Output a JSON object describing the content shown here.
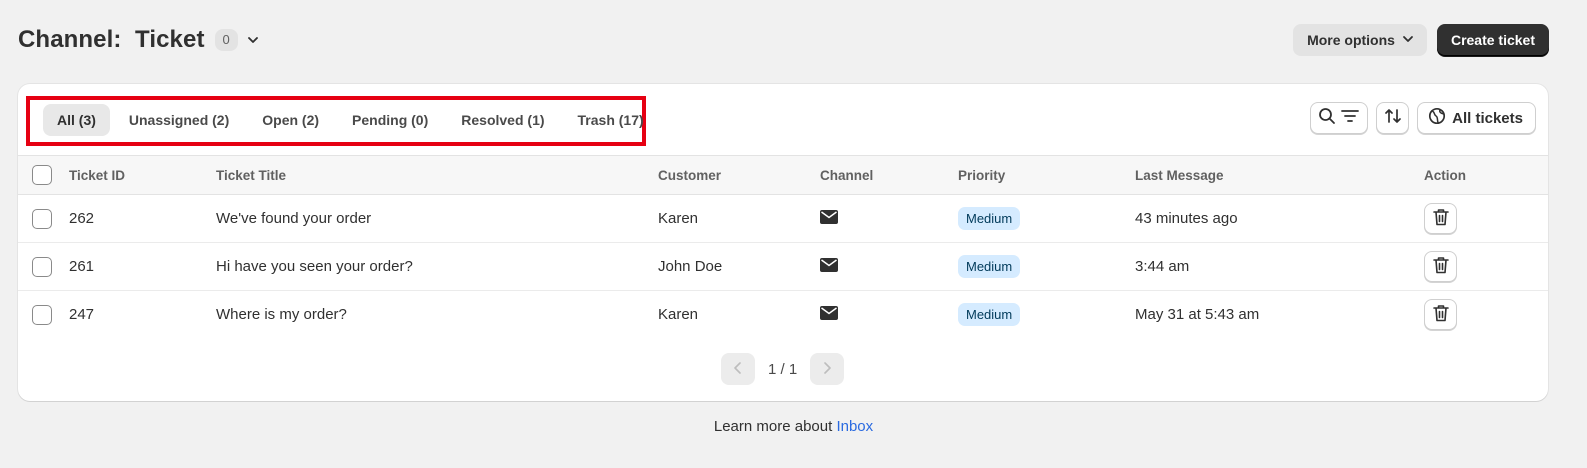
{
  "header": {
    "title": "Channel:  Ticket",
    "count_badge": "0",
    "more_options_label": "More options",
    "create_ticket_label": "Create ticket"
  },
  "tabs": [
    {
      "label": "All (3)",
      "active": true
    },
    {
      "label": "Unassigned (2)",
      "active": false
    },
    {
      "label": "Open (2)",
      "active": false
    },
    {
      "label": "Pending (0)",
      "active": false
    },
    {
      "label": "Resolved (1)",
      "active": false
    },
    {
      "label": "Trash (17)",
      "active": false
    }
  ],
  "toolbar": {
    "all_tickets_label": "All tickets"
  },
  "table": {
    "columns": [
      "Ticket ID",
      "Ticket Title",
      "Customer",
      "Channel",
      "Priority",
      "Last Message",
      "Action"
    ],
    "rows": [
      {
        "id": "262",
        "title": "We've found your order",
        "customer": "Karen",
        "channel": "email-icon",
        "priority": "Medium",
        "last_message": "43 minutes ago"
      },
      {
        "id": "261",
        "title": "Hi have you seen your order?",
        "customer": "John Doe",
        "channel": "email-icon",
        "priority": "Medium",
        "last_message": "3:44 am"
      },
      {
        "id": "247",
        "title": "Where is my order?",
        "customer": "Karen",
        "channel": "email-icon",
        "priority": "Medium",
        "last_message": "May 31 at 5:43 am"
      }
    ]
  },
  "pagination": {
    "label": "1 / 1"
  },
  "footer": {
    "text": "Learn more about ",
    "link": "Inbox"
  },
  "colors": {
    "highlight_border": "#e60012",
    "primary_button": "#303030",
    "priority_badge_bg": "#d5ebff",
    "link": "#2a6ae0"
  }
}
